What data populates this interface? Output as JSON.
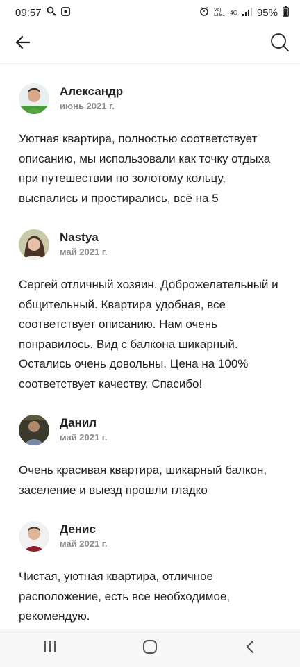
{
  "status_bar": {
    "time": "09:57",
    "network_top": "Vo)",
    "network_bottom": "LTE1",
    "signal_type": "4G",
    "battery": "95%"
  },
  "toolbar": {
    "back_icon": "arrow-left-icon",
    "search_icon": "search-icon"
  },
  "reviews": [
    {
      "author": "Александр",
      "date": "июнь 2021 г.",
      "text": "Уютная квартира, полностью соответствует описанию, мы использовали как точку отдыха при путешествии по золотому кольцу, выспались и простирались, всё на 5"
    },
    {
      "author": "Nastya",
      "date": "май 2021 г.",
      "text": "Сергей отличный хозяин. Доброжелательный и общительный. Квартира удобная, все соответствует описанию. Нам очень понравилось. Вид с балкона шикарный. Остались очень довольны. Цена на 100% соответствует качеству. Спасибо!"
    },
    {
      "author": "Данил",
      "date": "май 2021 г.",
      "text": "Очень красивая квартира, шикарный балкон, заселение и выезд прошли гладко"
    },
    {
      "author": "Денис",
      "date": "май 2021 г.",
      "text": "Чистая, уютная квартира, отличное расположение, есть все необходимое, рекомендую."
    }
  ],
  "nav_bar": {
    "recents_icon": "recents-icon",
    "home_icon": "home-icon",
    "back_icon": "back-chevron-icon"
  }
}
